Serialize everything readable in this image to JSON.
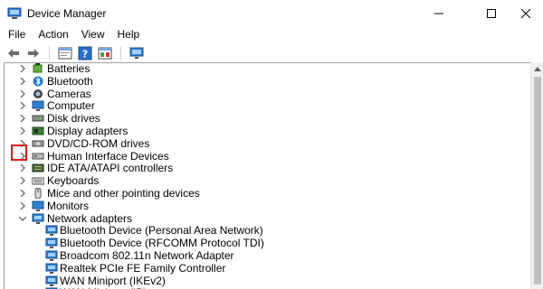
{
  "window": {
    "title": "Device Manager",
    "minimize_glyph": "—",
    "maximize_glyph": "☐",
    "close_glyph": "✕"
  },
  "menu": [
    {
      "label": "File"
    },
    {
      "label": "Action"
    },
    {
      "label": "View"
    },
    {
      "label": "Help"
    }
  ],
  "toolbar": {
    "icons": [
      "back-arrow-icon",
      "forward-arrow-icon",
      "properties-icon",
      "help-icon",
      "update-driver-icon",
      "monitor-scan-icon"
    ]
  },
  "tree": {
    "categories": [
      {
        "label": "Batteries",
        "icon": "battery-icon",
        "expanded": false
      },
      {
        "label": "Bluetooth",
        "icon": "bluetooth-icon",
        "expanded": false
      },
      {
        "label": "Cameras",
        "icon": "camera-icon",
        "expanded": false
      },
      {
        "label": "Computer",
        "icon": "computer-icon",
        "expanded": false
      },
      {
        "label": "Disk drives",
        "icon": "disk-drive-icon",
        "expanded": false
      },
      {
        "label": "Display adapters",
        "icon": "display-adapter-icon",
        "expanded": false
      },
      {
        "label": "DVD/CD-ROM drives",
        "icon": "dvd-drive-icon",
        "expanded": false
      },
      {
        "label": "Human Interface Devices",
        "icon": "hid-icon",
        "expanded": false
      },
      {
        "label": "IDE ATA/ATAPI controllers",
        "icon": "ide-controller-icon",
        "expanded": false
      },
      {
        "label": "Keyboards",
        "icon": "keyboard-icon",
        "expanded": false
      },
      {
        "label": "Mice and other pointing devices",
        "icon": "mouse-icon",
        "expanded": false
      },
      {
        "label": "Monitors",
        "icon": "monitor-icon",
        "expanded": false
      },
      {
        "label": "Network adapters",
        "icon": "network-adapter-icon",
        "expanded": true
      }
    ],
    "network_children": [
      {
        "label": "Bluetooth Device (Personal Area Network)"
      },
      {
        "label": "Bluetooth Device (RFCOMM Protocol TDI)"
      },
      {
        "label": "Broadcom 802.11n Network Adapter"
      },
      {
        "label": "Realtek PCIe FE Family Controller"
      },
      {
        "label": "WAN Miniport (IKEv2)"
      },
      {
        "label": "WAN Miniport (IP)"
      }
    ]
  },
  "colors": {
    "highlight_border": "#e01818",
    "icon_blue": "#1e78d2",
    "chevron": "#555555"
  }
}
